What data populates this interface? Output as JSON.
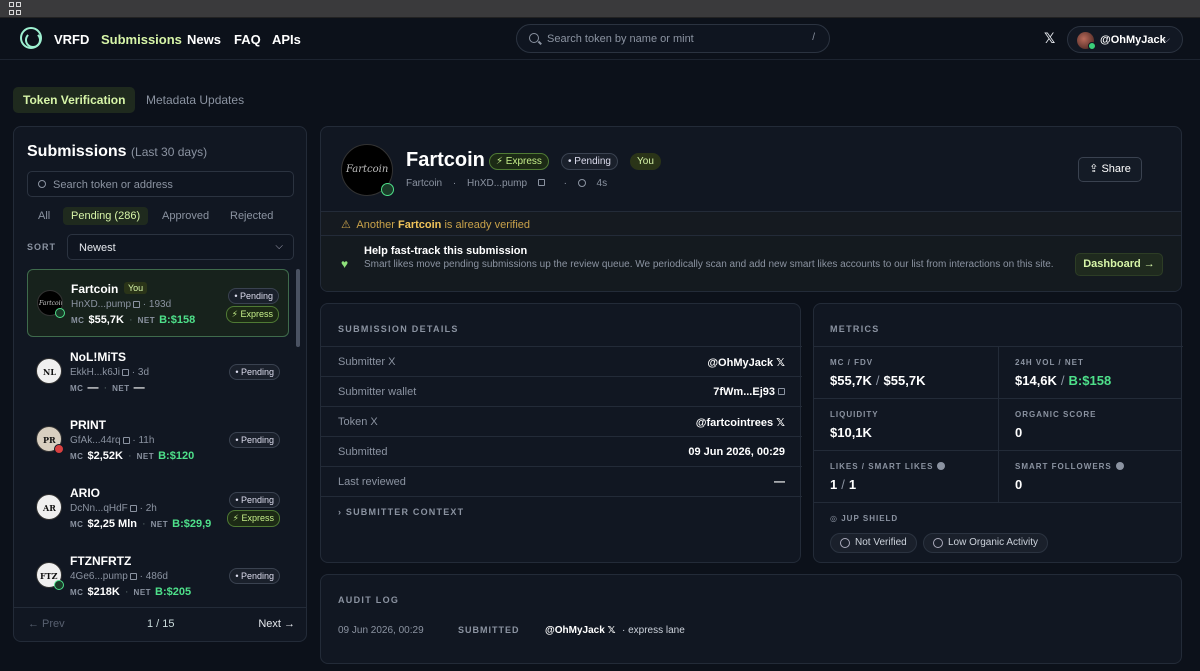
{
  "topnav": {
    "brand": "VRFD",
    "links": [
      "Submissions",
      "News",
      "FAQ",
      "APIs"
    ],
    "search_placeholder": "Search token by name or mint",
    "search_shortcut": "/",
    "x_glyph": "𝕏",
    "user": "@OhMyJack"
  },
  "page_tabs": [
    "Token Verification",
    "Metadata Updates"
  ],
  "sidebar": {
    "title": "Submissions",
    "subtitle": "(Last 30 days)",
    "search_placeholder": "Search token or address",
    "filters": [
      "All",
      "Pending (286)",
      "Approved",
      "Rejected"
    ],
    "sort_label": "SORT",
    "sort_value": "Newest",
    "tokens": [
      {
        "name": "Fartcoin",
        "you": "You",
        "addr": "HnXD...pump",
        "age": "193d",
        "mc": "$55,7K",
        "net": "B:$158",
        "status": "Pending",
        "express": "Express",
        "icon": "Fartcoin"
      },
      {
        "name": "NoL!MiTS",
        "you": "",
        "addr": "EkkH...k6Ji",
        "age": "3d",
        "mc": "—",
        "net": "—",
        "status": "Pending",
        "express": "",
        "icon": "NL"
      },
      {
        "name": "PRINT",
        "you": "",
        "addr": "GfAk...44rq",
        "age": "11h",
        "mc": "$2,52K",
        "net": "B:$120",
        "status": "Pending",
        "express": "",
        "icon": "PR"
      },
      {
        "name": "ARIO",
        "you": "",
        "addr": "DcNn...qHdF",
        "age": "2h",
        "mc": "$2,25 Mln",
        "net": "B:$29,9",
        "status": "Pending",
        "express": "Express",
        "icon": "AR"
      },
      {
        "name": "FTZNFRTZ",
        "you": "",
        "addr": "4Ge6...pump",
        "age": "486d",
        "mc": "$218K",
        "net": "B:$205",
        "status": "Pending",
        "express": "",
        "icon": "FTZ"
      }
    ],
    "labels": {
      "mc": "MC",
      "net": "NET"
    },
    "pager": {
      "prev": "← Prev",
      "count": "1 / 15",
      "next": "Next →"
    }
  },
  "header": {
    "icon_text": "Fartcoin",
    "name": "Fartcoin",
    "badge_express": "⚡ Express",
    "badge_pending": "• Pending",
    "badge_you": "You",
    "meta_symbol": "Fartcoin",
    "meta_addr": "HnXD...pump",
    "meta_age": "4s",
    "share": "Share",
    "warning_prefix": "Another",
    "warning_token": "Fartcoin",
    "warning_suffix": "is already verified",
    "help_title": "Help fast-track this submission",
    "help_text": "Smart likes move pending submissions up the review queue. We periodically scan and add new smart likes accounts to our list from interactions on this site.",
    "dashboard": "Dashboard →"
  },
  "details": {
    "title": "SUBMISSION DETAILS",
    "rows": [
      {
        "k": "Submitter X",
        "v": "@OhMyJack 𝕏"
      },
      {
        "k": "Submitter wallet",
        "v": "7fWm...Ej93"
      },
      {
        "k": "Token X",
        "v": "@fartcointrees 𝕏"
      },
      {
        "k": "Submitted",
        "v": "09 Jun 2026, 00:29"
      },
      {
        "k": "Last reviewed",
        "v": "—"
      }
    ],
    "context": "SUBMITTER CONTEXT"
  },
  "metrics": {
    "title": "METRICS",
    "cells": [
      {
        "k": "MC / FDV",
        "a": "$55,7K",
        "b": "$55,7K"
      },
      {
        "k": "24H VOL / NET",
        "a": "$14,6K",
        "b": "B:$158"
      },
      {
        "k": "LIQUIDITY",
        "a": "$10,1K"
      },
      {
        "k": "ORGANIC SCORE",
        "a": "0"
      },
      {
        "k": "LIKES / SMART LIKES",
        "a": "1",
        "b": "1"
      },
      {
        "k": "SMART FOLLOWERS",
        "a": "0"
      }
    ],
    "shield_title": "JUP SHIELD",
    "chips": [
      "Not Verified",
      "Low Organic Activity"
    ]
  },
  "audit": {
    "title": "AUDIT LOG",
    "date": "09 Jun 2026, 00:29",
    "action": "SUBMITTED",
    "user": "@OhMyJack 𝕏",
    "note": "· express lane"
  }
}
